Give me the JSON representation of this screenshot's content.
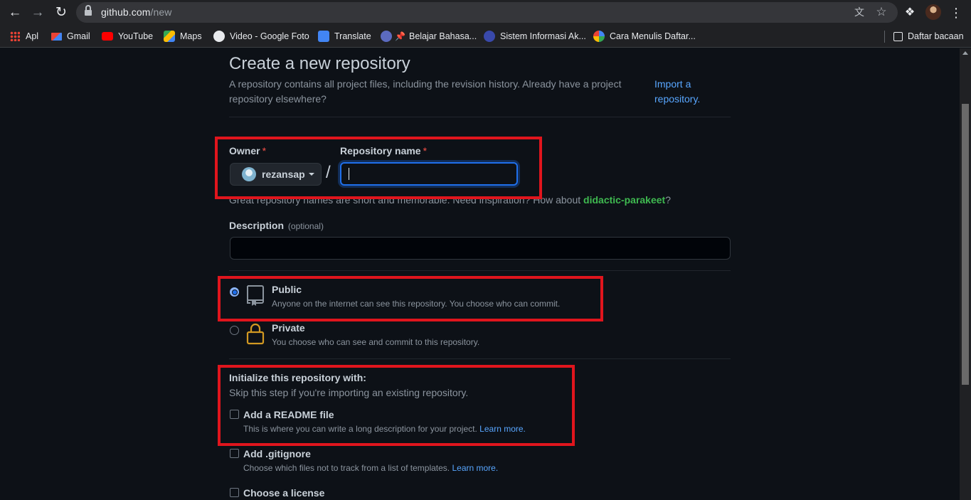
{
  "browser": {
    "url_host": "github.com",
    "url_path": "/new",
    "bookmarks": [
      {
        "label": "Apl",
        "icon": "apps-grid-icon"
      },
      {
        "label": "Gmail",
        "icon": "gmail-icon",
        "color": "#ea4335"
      },
      {
        "label": "YouTube",
        "icon": "youtube-icon",
        "color": "#ff0000"
      },
      {
        "label": "Maps",
        "icon": "maps-icon",
        "color": "#34a853"
      },
      {
        "label": "Video - Google Foto",
        "icon": "photos-icon",
        "color": "#e8eaed"
      },
      {
        "label": "Translate",
        "icon": "translate-icon",
        "color": "#4285f4"
      },
      {
        "label": "Belajar Bahasa...",
        "icon": "pin-icon",
        "color": "#e53935"
      },
      {
        "label": "Sistem Informasi Ak...",
        "icon": "campus-icon",
        "color": "#3949ab"
      },
      {
        "label": "Cara Menulis Daftar...",
        "icon": "google-icon",
        "color": "#4285f4"
      }
    ],
    "reading_list": "Daftar bacaan"
  },
  "page": {
    "title": "Create a new repository",
    "subtitle": "A repository contains all project files, including the revision history. Already have a project repository elsewhere?",
    "import_link": "Import a repository.",
    "owner_label": "Owner",
    "required_mark": "*",
    "owner_name": "rezansap",
    "slash": "/",
    "repo_name_label": "Repository name",
    "repo_name_value": "",
    "hint_prefix": "Great repository names are short and memorable. Need inspiration? How about ",
    "hint_suggestion": "didactic-parakeet",
    "hint_suffix": "?",
    "description_label": "Description",
    "description_optional": "(optional)",
    "description_value": "",
    "visibility": [
      {
        "title": "Public",
        "desc": "Anyone on the internet can see this repository. You choose who can commit.",
        "checked": true,
        "icon": "repo-book-icon"
      },
      {
        "title": "Private",
        "desc": "You choose who can see and commit to this repository.",
        "checked": false,
        "icon": "lock-icon"
      }
    ],
    "init_title": "Initialize this repository with:",
    "init_subtitle": "Skip this step if you're importing an existing repository.",
    "init_options": [
      {
        "title": "Add a README file",
        "desc": "This is where you can write a long description for your project.",
        "link": "Learn more."
      },
      {
        "title": "Add .gitignore",
        "desc": "Choose which files not to track from a list of templates.",
        "link": "Learn more."
      },
      {
        "title": "Choose a license",
        "desc": "",
        "link": ""
      }
    ]
  },
  "colors": {
    "background": "#0d1117",
    "link": "#58a6ff",
    "suggestion": "#3fb950",
    "required": "#f85149",
    "highlight": "#e0151d",
    "focus": "#1f6feb"
  }
}
